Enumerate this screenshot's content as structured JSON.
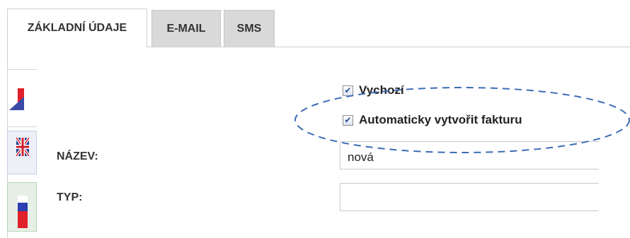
{
  "tabs": [
    {
      "label": "ZÁKLADNÍ ÚDAJE",
      "active": true
    },
    {
      "label": "E-MAIL",
      "active": false
    },
    {
      "label": "SMS",
      "active": false
    }
  ],
  "languages": [
    "cz-flag-icon",
    "uk-flag-icon",
    "ru-flag-icon"
  ],
  "checkboxes": {
    "default": {
      "label": "Vychozí",
      "checked": true
    },
    "auto_invoice": {
      "label": "Automaticky vytvořit fakturu",
      "checked": true
    }
  },
  "fields": {
    "name": {
      "label": "NÁZEV:",
      "value": "nová"
    },
    "type": {
      "label": "TYP:",
      "value": ""
    }
  },
  "colors": {
    "checkmark": "#2b4a94",
    "annotation": "#3b6cb5"
  }
}
